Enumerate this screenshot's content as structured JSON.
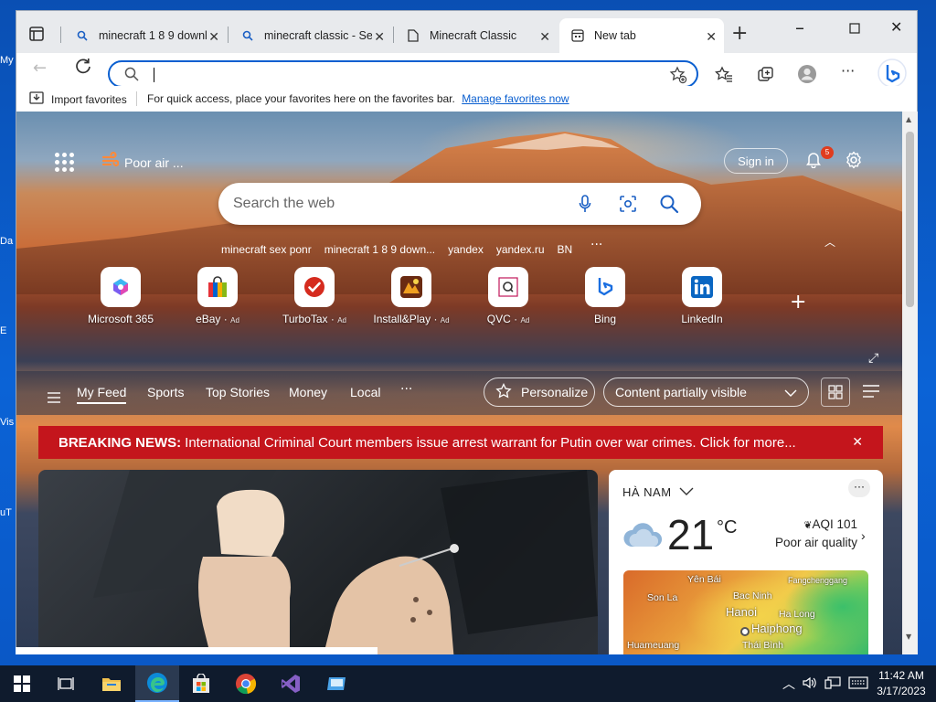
{
  "desktop": {
    "edge_fragments": [
      "My",
      "Da",
      "E",
      "Vis",
      "uT"
    ]
  },
  "tabs": [
    {
      "title": "minecraft 1 8 9 downl",
      "icon": "search-icon"
    },
    {
      "title": "minecraft classic - Sea",
      "icon": "search-icon"
    },
    {
      "title": "Minecraft Classic",
      "icon": "page-icon"
    },
    {
      "title": "New tab",
      "icon": "newtab-icon",
      "active": true
    }
  ],
  "address_bar": {
    "value": "",
    "placeholder": ""
  },
  "favorites_bar": {
    "import_label": "Import favorites",
    "message": "For quick access, place your favorites here on the favorites bar.",
    "manage_link": "Manage favorites now"
  },
  "ntp": {
    "air_quality_label": "Poor air ...",
    "sign_in": "Sign in",
    "notification_count": "5",
    "search_placeholder": "Search the web",
    "recent_searches": [
      "minecraft sex ponr",
      "minecraft 1 8 9 down...",
      "yandex",
      "yandex.ru",
      "BN"
    ],
    "tiles": [
      {
        "label": "Microsoft 365",
        "ad": ""
      },
      {
        "label": "eBay",
        "ad": "Ad"
      },
      {
        "label": "TurboTax",
        "ad": "Ad"
      },
      {
        "label": "Install&Play",
        "ad": "Ad"
      },
      {
        "label": "QVC",
        "ad": "Ad"
      },
      {
        "label": "Bing",
        "ad": ""
      },
      {
        "label": "LinkedIn",
        "ad": ""
      }
    ],
    "feed_tabs": [
      "My Feed",
      "Sports",
      "Top Stories",
      "Money",
      "Local"
    ],
    "feed_more": "···",
    "personalize": "Personalize",
    "content_visibility": "Content partially visible",
    "breaking_label": "BREAKING NEWS:",
    "breaking_text": "International Criminal Court members issue arrest warrant for Putin over war crimes. Click for more...",
    "weather": {
      "location": "HÀ NAM",
      "temperature": "21",
      "unit": "°C",
      "aqi": "AQI 101",
      "quality": "Poor air quality",
      "map_places": [
        "Yên Bái",
        "Bac Ninh",
        "Fangchenggang",
        "Son La",
        "Hanoi",
        "Ha Long",
        "Haiphong",
        "Huameuang",
        "Thái Bình"
      ]
    }
  },
  "taskbar": {
    "time": "11:42 AM",
    "date": "3/17/2023"
  },
  "colors": {
    "accent": "#0a5fd0",
    "breaking": "#c4151c",
    "taskbar": "#0f1b2d"
  }
}
